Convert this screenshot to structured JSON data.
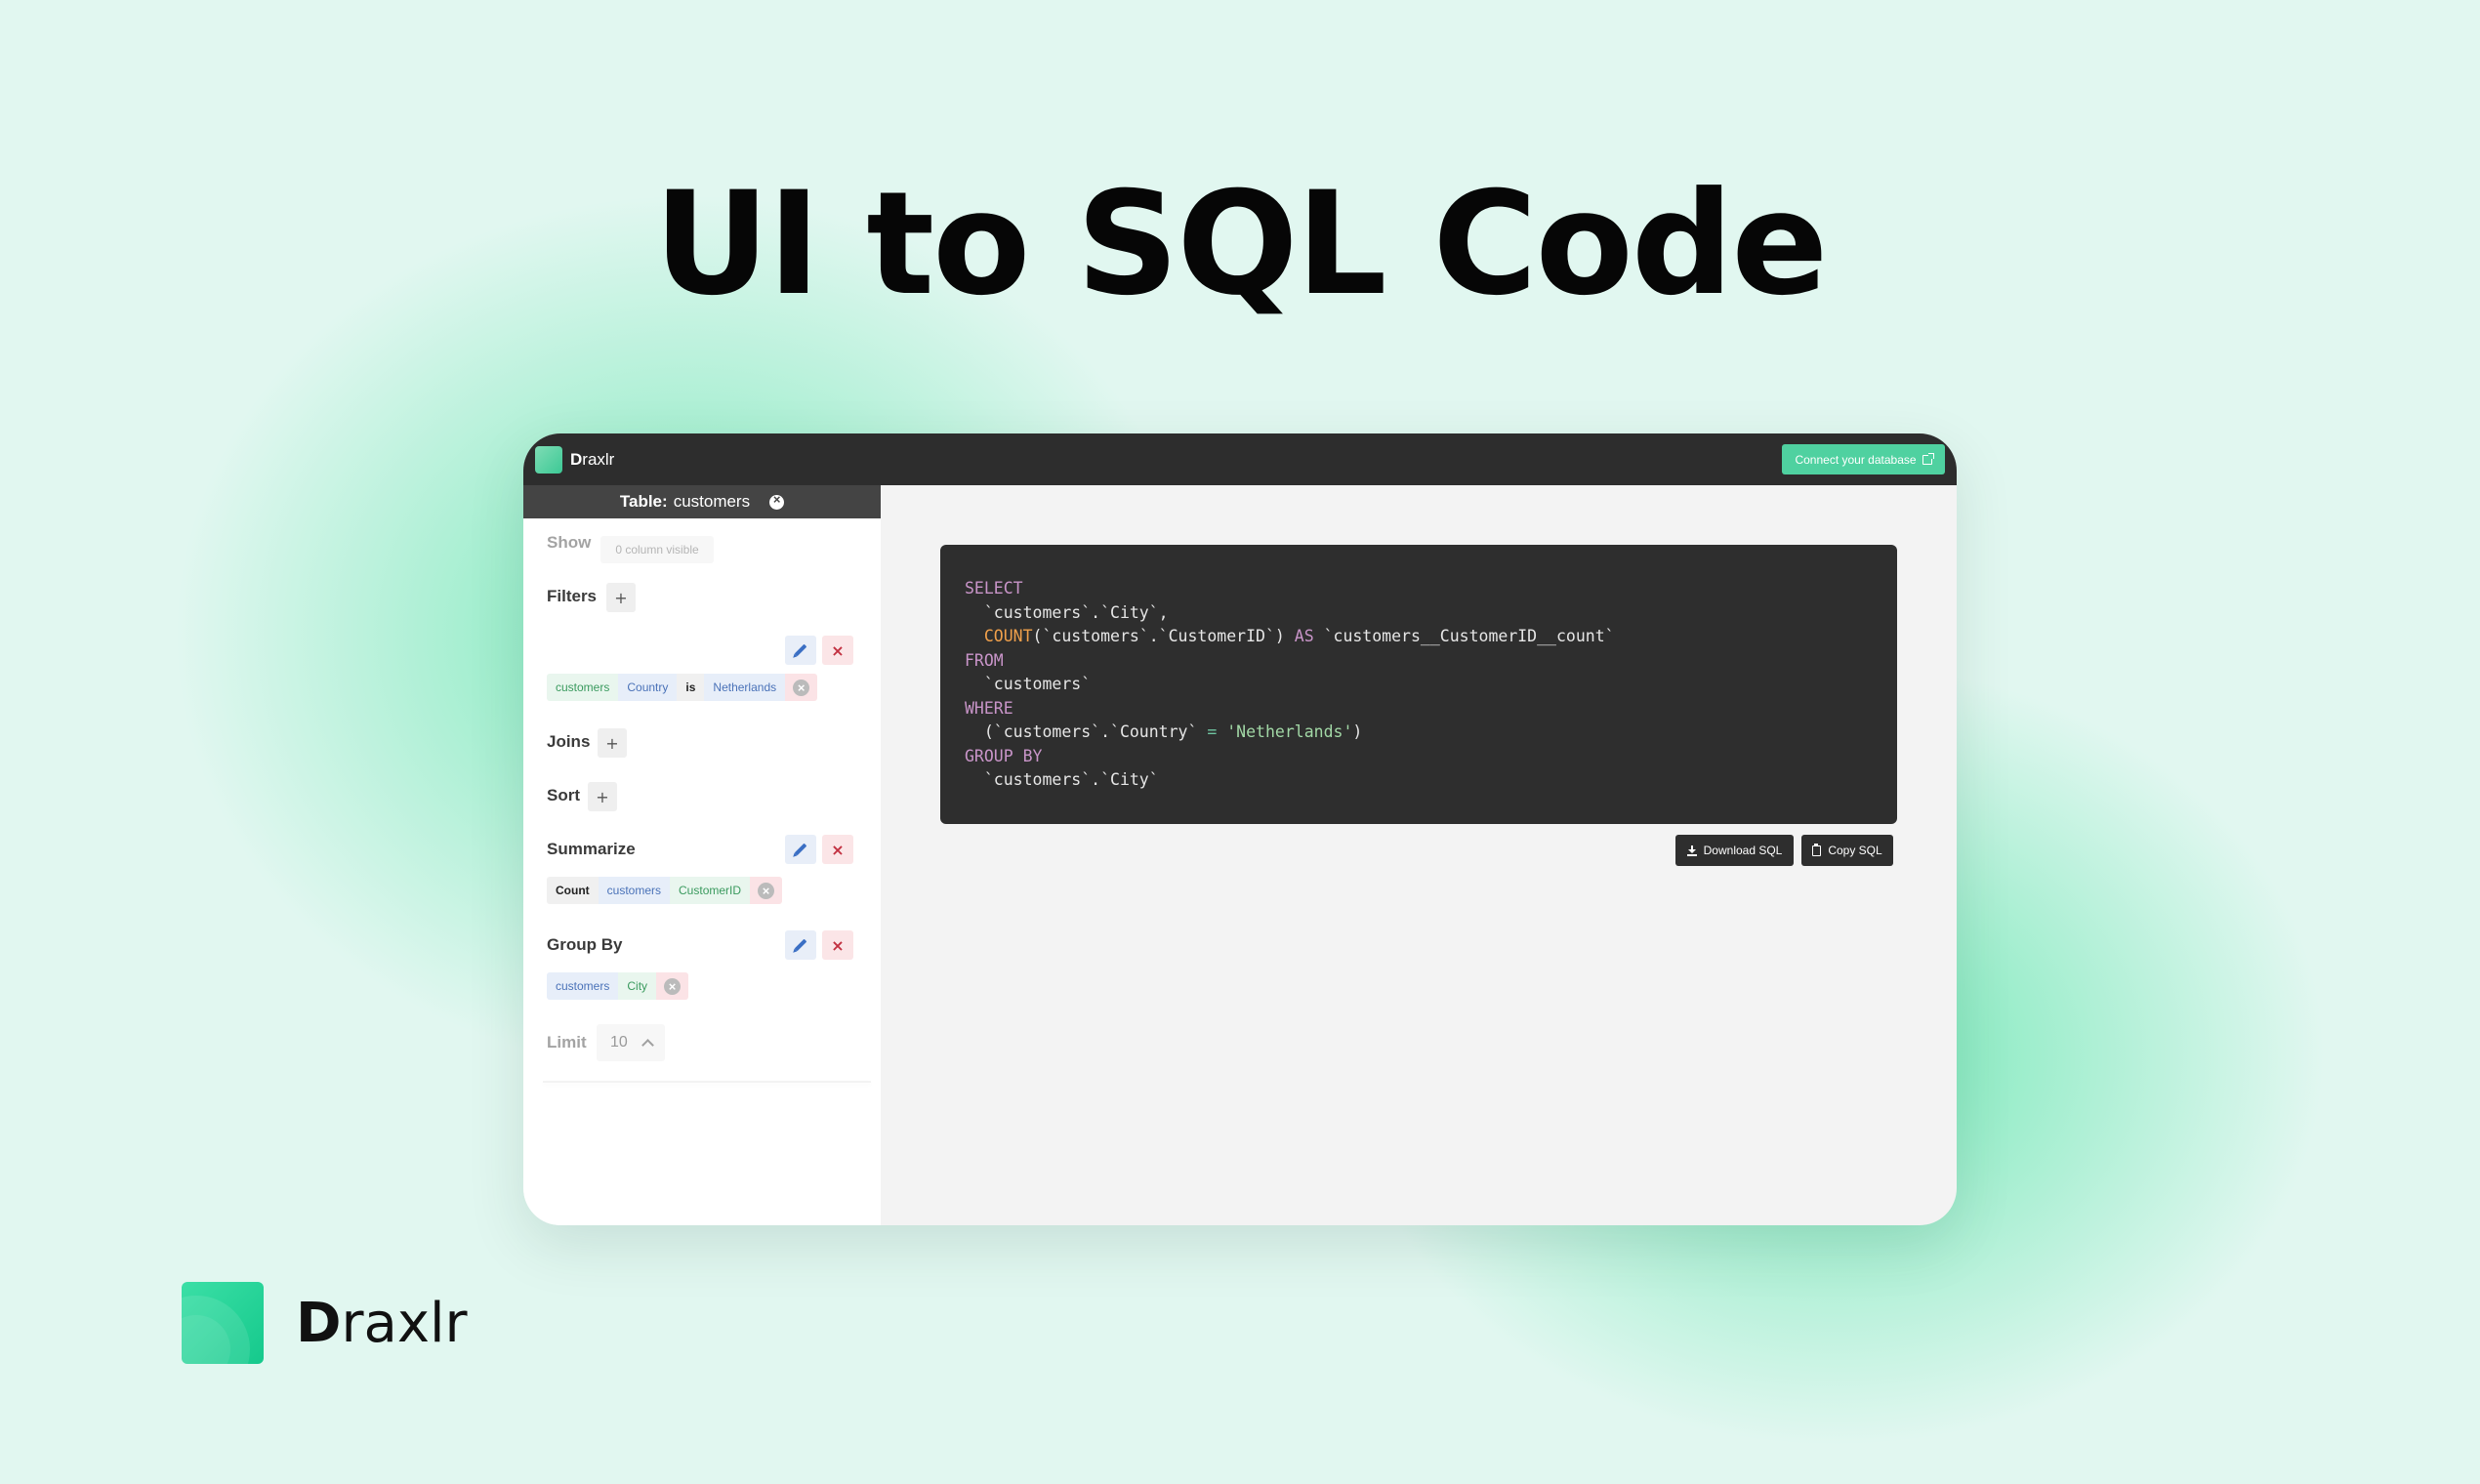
{
  "hero": {
    "title": "UI to SQL Code"
  },
  "app": {
    "name_first": "D",
    "name_rest": "raxlr",
    "connect_label": "Connect your database"
  },
  "sidebar": {
    "table_label": "Table:",
    "table_name": "customers",
    "show": {
      "label": "Show",
      "value": "0 column visible"
    },
    "filters": {
      "label": "Filters",
      "add": "+",
      "chips": [
        "customers",
        "Country",
        "is",
        "Netherlands"
      ]
    },
    "joins": {
      "label": "Joins",
      "add": "+"
    },
    "sort": {
      "label": "Sort",
      "add": "+"
    },
    "summarize": {
      "label": "Summarize",
      "chips": [
        "Count",
        "customers",
        "CustomerID"
      ]
    },
    "group_by": {
      "label": "Group By",
      "chips": [
        "customers",
        "City"
      ]
    },
    "limit": {
      "label": "Limit",
      "value": "10"
    }
  },
  "sql": {
    "lines": [
      [
        {
          "t": "SELECT",
          "c": "kw"
        }
      ],
      [
        {
          "t": "  `customers`.`City`,",
          "c": ""
        }
      ],
      [
        {
          "t": "  ",
          "c": ""
        },
        {
          "t": "COUNT",
          "c": "fn"
        },
        {
          "t": "(`customers`.`CustomerID`) ",
          "c": ""
        },
        {
          "t": "AS",
          "c": "kw"
        },
        {
          "t": " `customers__CustomerID__count`",
          "c": ""
        }
      ],
      [
        {
          "t": "FROM",
          "c": "kw"
        }
      ],
      [
        {
          "t": "  `customers`",
          "c": ""
        }
      ],
      [
        {
          "t": "WHERE",
          "c": "kw"
        }
      ],
      [
        {
          "t": "  (`customers`.`Country` ",
          "c": ""
        },
        {
          "t": "=",
          "c": "op"
        },
        {
          "t": " ",
          "c": ""
        },
        {
          "t": "'Netherlands'",
          "c": "str"
        },
        {
          "t": ")",
          "c": ""
        }
      ],
      [
        {
          "t": "GROUP BY",
          "c": "kw"
        }
      ],
      [
        {
          "t": "  `customers`.`City`",
          "c": ""
        }
      ]
    ]
  },
  "actions": {
    "download": "Download SQL",
    "copy": "Copy SQL"
  },
  "brand": {
    "name_first": "D",
    "name_rest": "raxlr"
  },
  "colors": {
    "accent": "#4fd1a0",
    "dark": "#2d2d2d",
    "background": "#e1f7f0"
  }
}
